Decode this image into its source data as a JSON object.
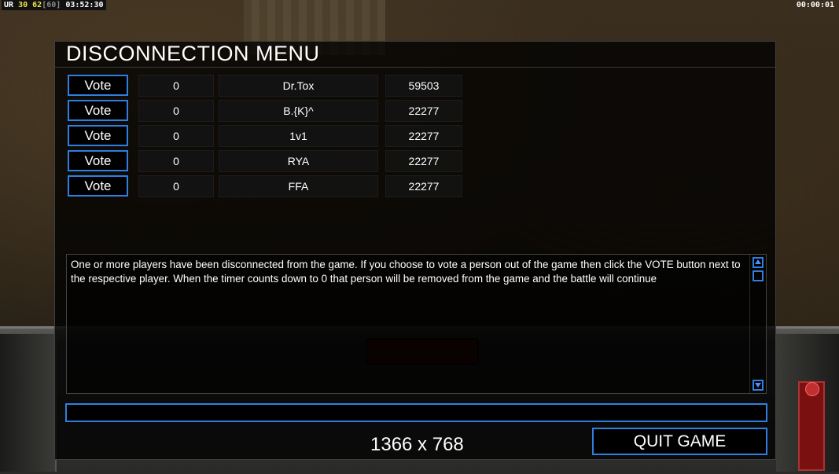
{
  "status": {
    "top_left": {
      "a": "UR",
      "b": "30",
      "c": "62",
      "d": "[60]",
      "time": "03:52:30"
    },
    "top_right_time": "00:00:01"
  },
  "dialog": {
    "title": "DISCONNECTION MENU",
    "vote_label": "Vote",
    "players": [
      {
        "count": "0",
        "name": "Dr.Tox",
        "ping": "59503"
      },
      {
        "count": "0",
        "name": "B.{K}^",
        "ping": "22277"
      },
      {
        "count": "0",
        "name": "1v1",
        "ping": "22277"
      },
      {
        "count": "0",
        "name": "RYA",
        "ping": "22277"
      },
      {
        "count": "0",
        "name": "FFA",
        "ping": "22277"
      }
    ],
    "message": "One or more players have been disconnected from the game. If you choose to vote a person out of the game then click the VOTE button next to the respective player. When the timer counts down to 0 that person will be removed from the game and the battle will continue",
    "chat_input_value": "",
    "resolution_text": "1366 x 768",
    "quit_label": "QUIT GAME"
  },
  "colors": {
    "accent_border": "#2f7ee0",
    "panel_bg": "#000000"
  }
}
